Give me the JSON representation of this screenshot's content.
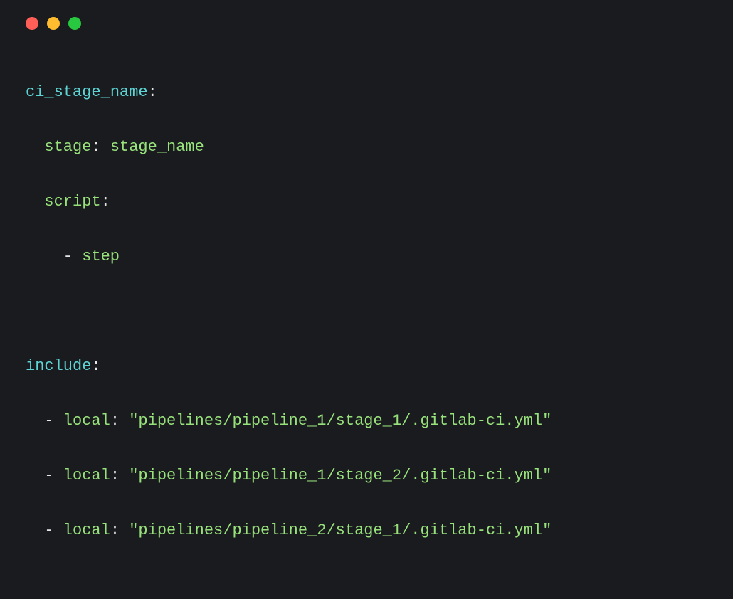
{
  "code": {
    "job_key": "ci_stage_name",
    "stage_key": "stage",
    "stage_value": "stage_name",
    "script_key": "script",
    "script_item": "step",
    "include_key": "include",
    "local_key": "local",
    "includes": [
      "\"pipelines/pipeline_1/stage_1/.gitlab-ci.yml\"",
      "\"pipelines/pipeline_1/stage_2/.gitlab-ci.yml\"",
      "\"pipelines/pipeline_2/stage_1/.gitlab-ci.yml\""
    ]
  },
  "punct": {
    "colon": ":",
    "dash": "- ",
    "space": " "
  }
}
